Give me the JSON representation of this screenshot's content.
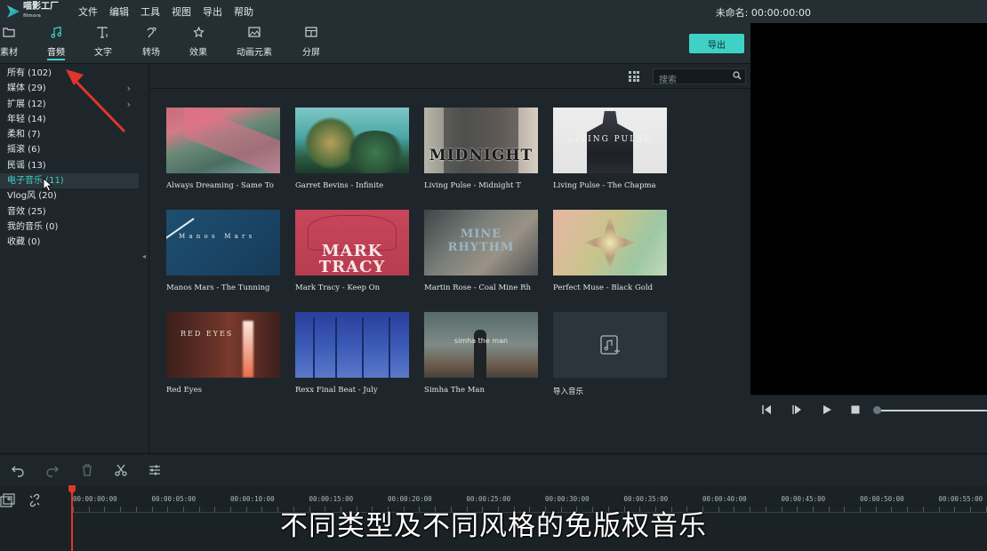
{
  "app": {
    "name": "喵影工厂",
    "sub": "filmora",
    "status": "未命名: 00:00:00:00"
  },
  "menu": [
    "文件",
    "编辑",
    "工具",
    "视图",
    "导出",
    "帮助"
  ],
  "toolbar": {
    "tabs": [
      {
        "label": "素材",
        "icon": "folder-icon"
      },
      {
        "label": "音频",
        "icon": "music-note-icon"
      },
      {
        "label": "文字",
        "icon": "text-icon"
      },
      {
        "label": "转场",
        "icon": "transition-icon"
      },
      {
        "label": "效果",
        "icon": "effects-icon"
      },
      {
        "label": "动画元素",
        "icon": "image-icon"
      },
      {
        "label": "分屏",
        "icon": "split-screen-icon"
      }
    ],
    "active": "音频",
    "export_label": "导出"
  },
  "sidebar": {
    "categories": [
      {
        "label": "所有 (102)",
        "chevron": false
      },
      {
        "label": "媒体 (29)",
        "chevron": true
      },
      {
        "label": "扩展 (12)",
        "chevron": true
      },
      {
        "label": "年轻 (14)",
        "chevron": false
      },
      {
        "label": "柔和 (7)",
        "chevron": false
      },
      {
        "label": "摇滚 (6)",
        "chevron": false
      },
      {
        "label": "民谣 (13)",
        "chevron": false
      },
      {
        "label": "电子音乐 (11)",
        "chevron": false
      },
      {
        "label": "Vlog风 (20)",
        "chevron": false
      },
      {
        "label": "音效 (25)",
        "chevron": false
      },
      {
        "label": "我的音乐 (0)",
        "chevron": false
      },
      {
        "label": "收藏 (0)",
        "chevron": false
      }
    ],
    "active_index": 7
  },
  "search": {
    "placeholder": "搜索"
  },
  "tracks": [
    {
      "label": "Always Dreaming - Same To",
      "thumb_text": ""
    },
    {
      "label": "Garret Bevins - Infinite",
      "thumb_text": ""
    },
    {
      "label": "Living Pulse - Midnight T",
      "thumb_text": "MIDNIGHT"
    },
    {
      "label": "Living Pulse - The Chapma",
      "thumb_text": "LIVING PULSE"
    },
    {
      "label": "Manos Mars - The Tunning",
      "thumb_text": "M a n o s   M a r s"
    },
    {
      "label": "Mark Tracy - Keep On",
      "thumb_text": "MARK TRACY"
    },
    {
      "label": "Martin Rose - Coal Mine Rh",
      "thumb_text": "MINE RHYTHM"
    },
    {
      "label": "Perfect Muse - Black Gold",
      "thumb_text": ""
    },
    {
      "label": "Red Eyes",
      "thumb_text": "RED EYES"
    },
    {
      "label": "Rexx Final Beat - July",
      "thumb_text": ""
    },
    {
      "label": "Simha The Man",
      "thumb_text": "simha the man"
    }
  ],
  "import": {
    "label": "导入音乐",
    "icon": "import-music-icon"
  },
  "timeline": {
    "ruler": [
      "00:00:00:00",
      "00:00:05:00",
      "00:00:10:00",
      "00:00:15:00",
      "00:00:20:00",
      "00:00:25:00",
      "00:00:30:00",
      "00:00:35:00",
      "00:00:40:00",
      "00:00:45:00",
      "00:00:50:00",
      "00:00:55:00"
    ]
  },
  "subtitle": "不同类型及不同风格的免版权音乐",
  "colors": {
    "accent": "#3fd1c6",
    "playhead": "#e0352b",
    "arrow": "#e0352b"
  }
}
